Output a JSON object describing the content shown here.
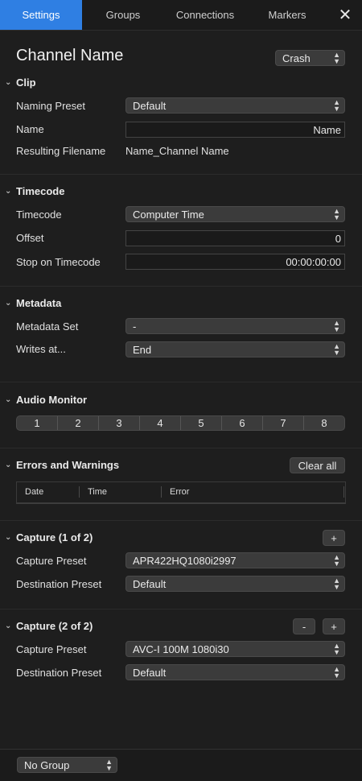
{
  "tabs": [
    {
      "label": "Settings",
      "active": true
    },
    {
      "label": "Groups",
      "active": false
    },
    {
      "label": "Connections",
      "active": false
    },
    {
      "label": "Markers",
      "active": false
    }
  ],
  "close_glyph": "✕",
  "channel": {
    "title": "Channel Name",
    "mode": "Crash"
  },
  "clip": {
    "header": "Clip",
    "naming_preset_label": "Naming Preset",
    "naming_preset_value": "Default",
    "name_label": "Name",
    "name_value": "Name",
    "resulting_label": "Resulting Filename",
    "resulting_value": "Name_Channel Name"
  },
  "timecode": {
    "header": "Timecode",
    "timecode_label": "Timecode",
    "timecode_value": "Computer Time",
    "offset_label": "Offset",
    "offset_value": "0",
    "stop_label": "Stop on Timecode",
    "stop_value": "00:00:00:00"
  },
  "metadata": {
    "header": "Metadata",
    "set_label": "Metadata Set",
    "set_value": "-",
    "writes_label": "Writes at...",
    "writes_value": "End"
  },
  "audio": {
    "header": "Audio Monitor",
    "channels": [
      "1",
      "2",
      "3",
      "4",
      "5",
      "6",
      "7",
      "8"
    ]
  },
  "errors": {
    "header": "Errors and Warnings",
    "clear_label": "Clear all",
    "columns": [
      "Date",
      "Time",
      "Error"
    ]
  },
  "capture1": {
    "header": "Capture (1 of 2)",
    "add_label": "+",
    "capture_label": "Capture Preset",
    "capture_value": "APR422HQ1080i2997",
    "dest_label": "Destination Preset",
    "dest_value": "Default"
  },
  "capture2": {
    "header": "Capture (2 of 2)",
    "remove_label": "-",
    "add_label": "+",
    "capture_label": "Capture Preset",
    "capture_value": "AVC-I 100M 1080i30",
    "dest_label": "Destination Preset",
    "dest_value": "Default"
  },
  "footer": {
    "group_value": "No Group"
  },
  "colors": {
    "accent": "#2f7fe3",
    "background": "#1e1e1e",
    "control": "#3b3b3b"
  },
  "icons": {
    "close": "close-icon",
    "chevron": "chevron-down-icon",
    "popup": "up-down-arrows-icon"
  }
}
